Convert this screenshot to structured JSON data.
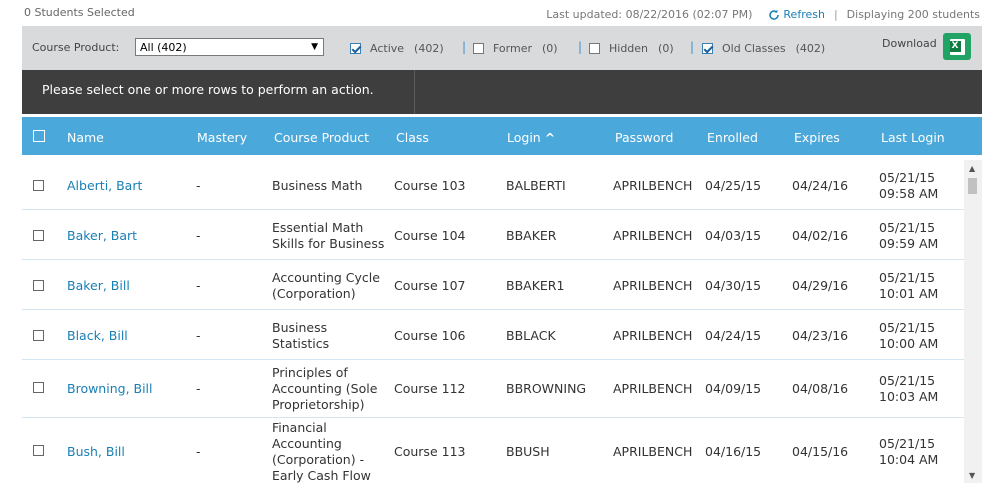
{
  "header": {
    "selected_count": "0 Students Selected",
    "last_updated": "Last updated: 08/22/2016 (02:07 PM)",
    "refresh_label": "Refresh",
    "separator": "|",
    "displaying": "Displaying 200 students"
  },
  "filters": {
    "course_product_label": "Course Product:",
    "course_product_value": "All (402)",
    "items": [
      {
        "label": "Active",
        "count": "(402)",
        "checked": true
      },
      {
        "label": "Former",
        "count": "(0)",
        "checked": false
      },
      {
        "label": "Hidden",
        "count": "(0)",
        "checked": false
      },
      {
        "label": "Old Classes",
        "count": "(402)",
        "checked": true
      }
    ],
    "download_label": "Download",
    "excel_icon_letter": "X"
  },
  "action_bar": {
    "message": "Please select one or more rows to perform an action."
  },
  "table": {
    "columns": [
      "Name",
      "Mastery",
      "Course Product",
      "Class",
      "Login",
      "Password",
      "Enrolled",
      "Expires",
      "Last Login"
    ],
    "sort_indicator": "^",
    "rows": [
      {
        "name": "Alberti, Bart",
        "mastery": "-",
        "course_product": [
          "Business Math"
        ],
        "class": "Course 103",
        "login": "BALBERTI",
        "password": "APRILBENCH",
        "enrolled": "04/25/15",
        "expires": "04/24/16",
        "last_login": [
          "05/21/15",
          "09:58 AM"
        ]
      },
      {
        "name": "Baker, Bart",
        "mastery": "-",
        "course_product": [
          "Essential Math",
          "Skills for Business"
        ],
        "class": "Course 104",
        "login": "BBAKER",
        "password": "APRILBENCH",
        "enrolled": "04/03/15",
        "expires": "04/02/16",
        "last_login": [
          "05/21/15",
          "09:59 AM"
        ]
      },
      {
        "name": "Baker, Bill",
        "mastery": "-",
        "course_product": [
          "Accounting Cycle",
          "(Corporation)"
        ],
        "class": "Course 107",
        "login": "BBAKER1",
        "password": "APRILBENCH",
        "enrolled": "04/30/15",
        "expires": "04/29/16",
        "last_login": [
          "05/21/15",
          "10:01 AM"
        ]
      },
      {
        "name": "Black, Bill",
        "mastery": "-",
        "course_product": [
          "Business",
          "Statistics"
        ],
        "class": "Course 106",
        "login": "BBLACK",
        "password": "APRILBENCH",
        "enrolled": "04/24/15",
        "expires": "04/23/16",
        "last_login": [
          "05/21/15",
          "10:00 AM"
        ]
      },
      {
        "name": "Browning, Bill",
        "mastery": "-",
        "course_product": [
          "Principles of",
          "Accounting (Sole",
          "Proprietorship)"
        ],
        "class": "Course 112",
        "login": "BBROWNING",
        "password": "APRILBENCH",
        "enrolled": "04/09/15",
        "expires": "04/08/16",
        "last_login": [
          "05/21/15",
          "10:03 AM"
        ]
      },
      {
        "name": "Bush, Bill",
        "mastery": "-",
        "course_product": [
          "Financial",
          "Accounting",
          "(Corporation) -",
          "Early Cash Flow"
        ],
        "class": "Course 113",
        "login": "BBUSH",
        "password": "APRILBENCH",
        "enrolled": "04/16/15",
        "expires": "04/15/16",
        "last_login": [
          "05/21/15",
          "10:04 AM"
        ]
      }
    ]
  },
  "colors": {
    "header_blue": "#4ba8db",
    "link_blue": "#1a7fb5",
    "action_bar": "#3e3e3e",
    "filter_bar": "#d9dadb",
    "excel_green": "#21a366"
  }
}
